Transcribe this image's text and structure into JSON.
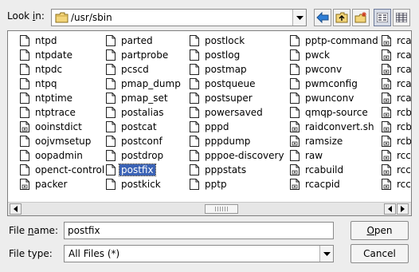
{
  "look_in": {
    "label_pre": "Look ",
    "label_key": "i",
    "label_post": "n:",
    "path": "/usr/sbin"
  },
  "toolbar": {
    "back_icon": "back-arrow-icon",
    "up_icon": "folder-up-icon",
    "new_folder_icon": "new-folder-icon",
    "list_view_icon": "list-view-icon",
    "detail_view_icon": "detail-view-icon"
  },
  "files": {
    "columns": [
      [
        "ntpd",
        "ntpdate",
        "ntpdc",
        "ntpq",
        "ntptime",
        "ntptrace",
        "ooinstdict",
        "oojvmsetup",
        "oopadmin",
        "openct-control",
        "packer"
      ],
      [
        "parted",
        "partprobe",
        "pcscd",
        "pmap_dump",
        "pmap_set",
        "postalias",
        "postcat",
        "postconf",
        "postdrop",
        "postfix",
        "postkick"
      ],
      [
        "postlock",
        "postlog",
        "postmap",
        "postqueue",
        "postsuper",
        "powersaved",
        "pppd",
        "pppdump",
        "pppoe-discovery",
        "pppstats",
        "pptp"
      ],
      [
        "pptp-command",
        "pwck",
        "pwconv",
        "pwmconfig",
        "pwunconv",
        "qmqp-source",
        "raidconvert.sh",
        "ramsize",
        "raw",
        "rcabuild",
        "rcacpid"
      ],
      [
        "rca",
        "rca",
        "rca",
        "rca",
        "rca",
        "rcb",
        "rcb",
        "rcb",
        "rcc",
        "rcc",
        "rcc"
      ]
    ],
    "script_items": [
      "ooinstdict",
      "packer",
      "raidconvert.sh",
      "ramsize",
      "rcabuild",
      "rcacpid",
      "rca",
      "rcb",
      "rcc"
    ],
    "selected": "postfix"
  },
  "file_name": {
    "label_pre": "File ",
    "label_key": "n",
    "label_post": "ame:",
    "value": "postfix"
  },
  "file_type": {
    "label": "File type:",
    "value": "All Files (*)"
  },
  "buttons": {
    "open_key": "O",
    "open_rest": "pen",
    "cancel": "Cancel"
  }
}
